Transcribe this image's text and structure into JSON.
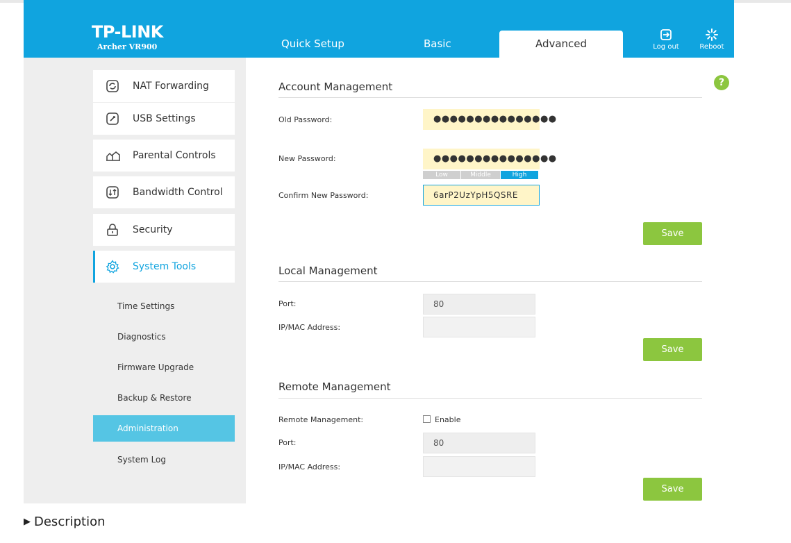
{
  "header": {
    "brand": "TP-LINK",
    "model": "Archer VR900",
    "tabs": [
      "Quick Setup",
      "Basic",
      "Advanced"
    ],
    "logout_label": "Log out",
    "reboot_label": "Reboot"
  },
  "sidebar": {
    "items": [
      {
        "label": "NAT Forwarding",
        "icon": "nat-forwarding-icon"
      },
      {
        "label": "USB Settings",
        "icon": "usb-settings-icon"
      },
      {
        "label": "Parental Controls",
        "icon": "parental-controls-icon"
      },
      {
        "label": "Bandwidth Control",
        "icon": "bandwidth-control-icon"
      },
      {
        "label": "Security",
        "icon": "lock-icon"
      },
      {
        "label": "System Tools",
        "icon": "gear-icon"
      }
    ],
    "subitems": [
      "Time Settings",
      "Diagnostics",
      "Firmware Upgrade",
      "Backup & Restore",
      "Administration",
      "System Log"
    ]
  },
  "help_label": "?",
  "account": {
    "title": "Account Management",
    "old_password_label": "Old Password:",
    "old_password_value": "●●●●●●●●●●●●●●●",
    "new_password_label": "New Password:",
    "new_password_value": "●●●●●●●●●●●●●●●",
    "strength": [
      "Low",
      "Middle",
      "High"
    ],
    "confirm_label": "Confirm New Password:",
    "confirm_value": "6arP2UzYpH5QSRE",
    "save_label": "Save"
  },
  "local": {
    "title": "Local Management",
    "port_label": "Port:",
    "port_value": "80",
    "ipmac_label": "IP/MAC Address:",
    "ipmac_value": "",
    "save_label": "Save"
  },
  "remote": {
    "title": "Remote Management",
    "remote_label": "Remote Management:",
    "enable_label": "Enable",
    "enabled": false,
    "port_label": "Port:",
    "port_value": "80",
    "ipmac_label": "IP/MAC Address:",
    "ipmac_value": "",
    "save_label": "Save"
  },
  "description_label": "Description",
  "colors": {
    "accent": "#10a4df",
    "save": "#8cc63f",
    "password_field": "#fff5c8",
    "submenu_active": "#55c5e4"
  }
}
